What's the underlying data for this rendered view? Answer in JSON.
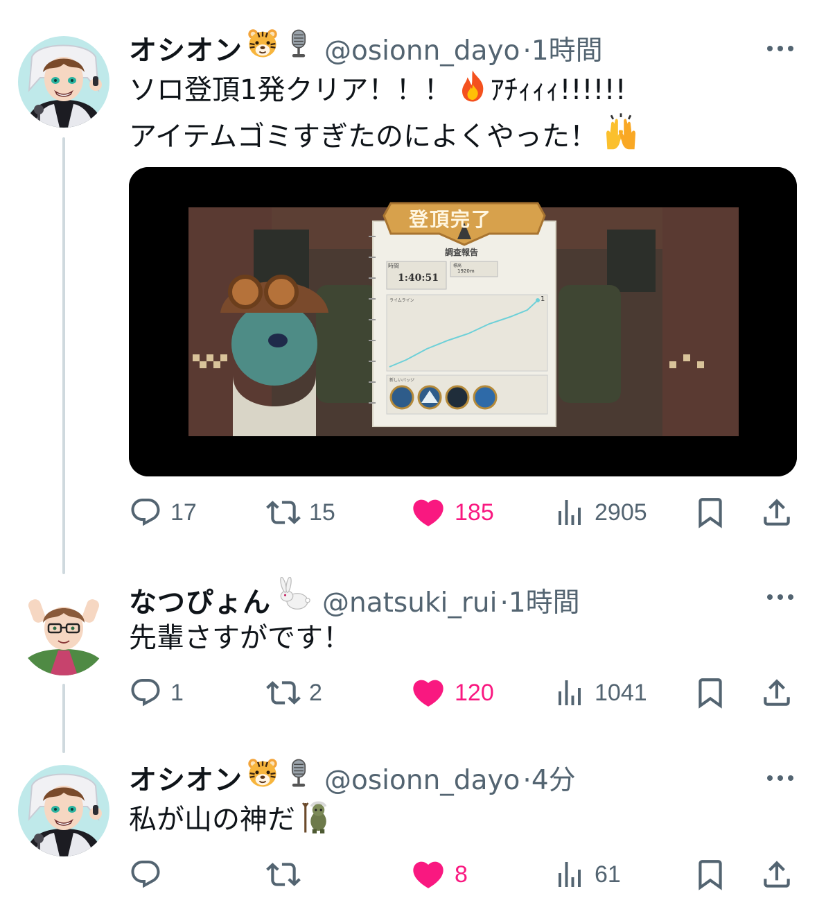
{
  "tweets": [
    {
      "name": "オシオン",
      "handle": "@osionn_dayo",
      "time": "·1時間",
      "lines": [
        "ソロ登頂1発クリア！！！",
        "ｱﾁｨｨｨ!!!!!!",
        "アイテムゴミすぎたのによくやった！"
      ],
      "media": {
        "banner": "登頂完了",
        "report_title": "調査報告",
        "time_label": "時間",
        "time_value": "1:40:51",
        "height_label": "標高",
        "height_value": "1920m",
        "chart_label": "ライムライン",
        "chart_end": "1",
        "badges_label": "新しいバッジ"
      },
      "stats": {
        "replies": "17",
        "reposts": "15",
        "likes": "185",
        "views": "2905"
      }
    },
    {
      "name": "なつぴょん",
      "handle": "@natsuki_rui",
      "time": "·1時間",
      "lines": [
        "先輩さすがです！"
      ],
      "stats": {
        "replies": "1",
        "reposts": "2",
        "likes": "120",
        "views": "1041"
      }
    },
    {
      "name": "オシオン",
      "handle": "@osionn_dayo",
      "time": "·4分",
      "lines": [
        "私が山の神だ"
      ],
      "stats": {
        "replies": "",
        "reposts": "",
        "likes": "8",
        "views": "61"
      }
    }
  ],
  "icons": [
    "reply-icon",
    "repost-icon",
    "like-icon",
    "views-icon",
    "bookmark-icon",
    "share-icon",
    "more-icon",
    "tiger-emoji",
    "microphone-emoji",
    "fire-emoji",
    "raising-hands-emoji",
    "rabbit-emoji",
    "troll-emoji"
  ],
  "colors": {
    "like": "#f91880",
    "secondary": "#536471",
    "text": "#0f1419",
    "thread": "#cfd9de"
  }
}
